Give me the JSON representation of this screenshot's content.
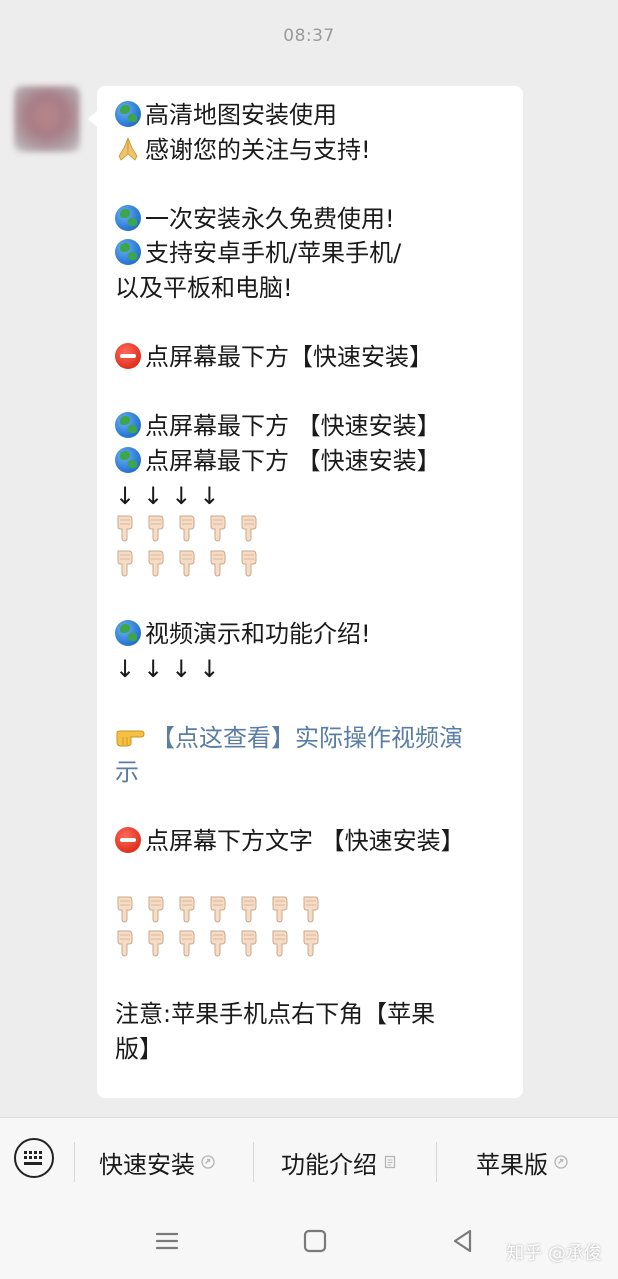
{
  "timestamp": "08:37",
  "message": {
    "lines": [
      {
        "icon": "globe",
        "text": "高清地图安装使用"
      },
      {
        "icon": "pray",
        "text": "感谢您的关注与支持!"
      },
      {
        "icon": null,
        "text": ""
      },
      {
        "icon": "globe",
        "text": "一次安装永久免费使用!"
      },
      {
        "icon": "globe",
        "text": "支持安卓手机/苹果手机/"
      },
      {
        "icon": null,
        "text": "以及平板和电脑!"
      },
      {
        "icon": null,
        "text": ""
      },
      {
        "icon": "stop",
        "text": "点屏幕最下方【快速安装】"
      },
      {
        "icon": null,
        "text": ""
      },
      {
        "icon": "globe",
        "text": "点屏幕最下方 【快速安装】"
      },
      {
        "icon": "globe",
        "text": "点屏幕最下方 【快速安装】"
      },
      {
        "icon": "arrows",
        "text": "↓↓↓↓"
      },
      {
        "icon": "hands5",
        "text": ""
      },
      {
        "icon": "hands5",
        "text": ""
      },
      {
        "icon": null,
        "text": ""
      },
      {
        "icon": "globe",
        "text": "视频演示和功能介绍!"
      },
      {
        "icon": "arrows",
        "text": "↓↓↓↓"
      },
      {
        "icon": null,
        "text": ""
      },
      {
        "icon": "point-right",
        "text": "【点这查看】实际操作视频演"
      },
      {
        "icon": "link-cont",
        "text": "示"
      },
      {
        "icon": null,
        "text": ""
      },
      {
        "icon": "stop",
        "text": "点屏幕下方文字 【快速安装】"
      },
      {
        "icon": null,
        "text": ""
      },
      {
        "icon": "hands7",
        "text": ""
      },
      {
        "icon": "hands7",
        "text": ""
      },
      {
        "icon": null,
        "text": ""
      },
      {
        "icon": null,
        "text": "注意:苹果手机点右下角【苹果"
      },
      {
        "icon": null,
        "text": "版】"
      }
    ]
  },
  "menu": {
    "items": [
      {
        "label": "快速安装",
        "icon": "link-icon"
      },
      {
        "label": "功能介绍",
        "icon": "doc-icon"
      },
      {
        "label": "苹果版",
        "icon": "link-icon"
      }
    ]
  },
  "watermark": "知乎 @承俊",
  "colors": {
    "background": "#ededed",
    "bubble": "#ffffff",
    "link": "#5a7da6",
    "menu_bg": "#f7f7f7"
  }
}
